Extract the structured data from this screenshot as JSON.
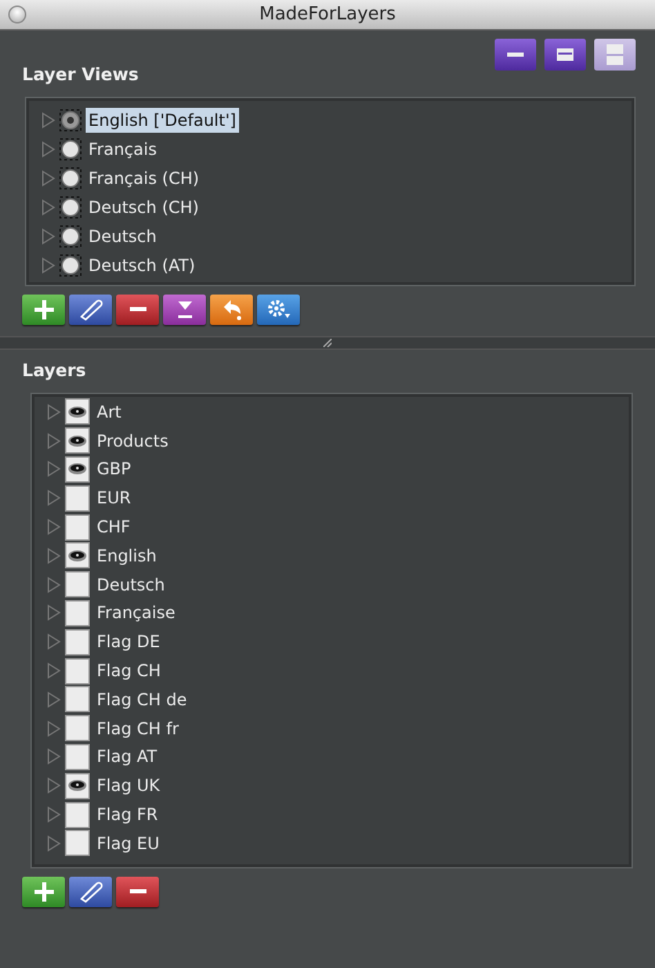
{
  "window": {
    "title": "MadeForLayers"
  },
  "top_buttons": [
    {
      "kind": "collapse",
      "disabled": false
    },
    {
      "kind": "restore",
      "disabled": false
    },
    {
      "kind": "expand",
      "disabled": true
    }
  ],
  "layer_views": {
    "title": "Layer Views",
    "items": [
      {
        "label": "English ['Default']",
        "selected": true
      },
      {
        "label": "Français",
        "selected": false
      },
      {
        "label": "Français (CH)",
        "selected": false
      },
      {
        "label": "Deutsch (CH)",
        "selected": false
      },
      {
        "label": "Deutsch",
        "selected": false
      },
      {
        "label": "Deutsch (AT)",
        "selected": false
      }
    ],
    "buttons": [
      {
        "kind": "add"
      },
      {
        "kind": "edit"
      },
      {
        "kind": "remove"
      },
      {
        "kind": "merge"
      },
      {
        "kind": "revert"
      },
      {
        "kind": "settings"
      }
    ]
  },
  "layers": {
    "title": "Layers",
    "items": [
      {
        "label": "Art",
        "visible": true
      },
      {
        "label": "Products",
        "visible": true
      },
      {
        "label": "GBP",
        "visible": true
      },
      {
        "label": "EUR",
        "visible": false
      },
      {
        "label": "CHF",
        "visible": false
      },
      {
        "label": "English",
        "visible": true
      },
      {
        "label": "Deutsch",
        "visible": false
      },
      {
        "label": "Française",
        "visible": false
      },
      {
        "label": "Flag DE",
        "visible": false
      },
      {
        "label": "Flag CH",
        "visible": false
      },
      {
        "label": "Flag CH de",
        "visible": false
      },
      {
        "label": "Flag CH fr",
        "visible": false
      },
      {
        "label": "Flag AT",
        "visible": false
      },
      {
        "label": "Flag UK",
        "visible": true
      },
      {
        "label": "Flag FR",
        "visible": false
      },
      {
        "label": "Flag EU",
        "visible": false
      }
    ],
    "buttons": [
      {
        "kind": "add"
      },
      {
        "kind": "edit"
      },
      {
        "kind": "remove"
      }
    ]
  }
}
